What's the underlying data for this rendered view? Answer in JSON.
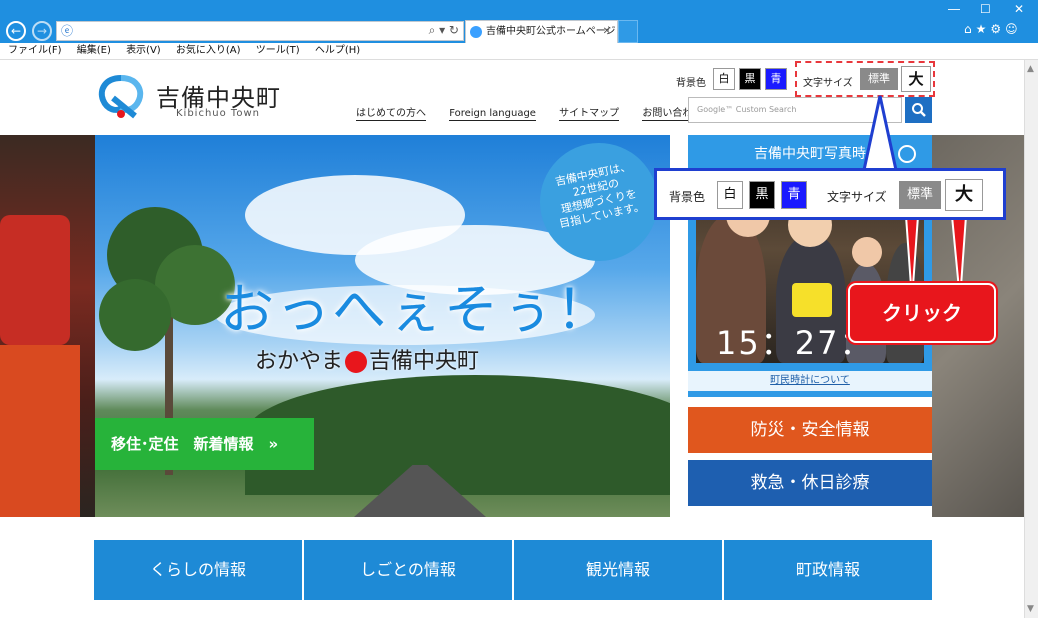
{
  "browser": {
    "tab_title": "吉備中央町公式ホームページ",
    "menu": [
      "ファイル(F)",
      "編集(E)",
      "表示(V)",
      "お気に入り(A)",
      "ツール(T)",
      "ヘルプ(H)"
    ]
  },
  "header": {
    "site_name": "吉備中央町",
    "site_name_roman": "Kibichuo Town",
    "bg_color_label": "背景色",
    "bg_white": "白",
    "bg_black": "黒",
    "bg_blue": "青",
    "font_size_label": "文字サイズ",
    "font_standard": "標準",
    "font_large": "大",
    "links": [
      "はじめての方へ",
      "Foreign language",
      "サイトマップ",
      "お問い合わせ"
    ],
    "search_placeholder": "Google™ Custom Search"
  },
  "hero": {
    "badge_lines": [
      "吉備中央町は、",
      "22世紀の",
      "理想郷づくりを",
      "目指しています。"
    ],
    "slogan": "おっへぇそぅ！",
    "subslogan_pre": "おかやま",
    "subslogan_post": "吉備中央町",
    "migrate_button": "移住･定住　新着情報　»"
  },
  "photo_panel": {
    "title": "吉備中央町写真時",
    "clock": "15：27：",
    "clock_link": "町民時計について"
  },
  "side_buttons": {
    "disaster": "防災・安全情報",
    "emergency": "救急・休日診療"
  },
  "callout": {
    "bg_color_label": "背景色",
    "bg_white": "白",
    "bg_black": "黒",
    "bg_blue": "青",
    "font_size_label": "文字サイズ",
    "font_standard": "標準",
    "font_large": "大",
    "click_label": "クリック"
  },
  "categories": [
    "くらしの情報",
    "しごとの情報",
    "観光情報",
    "町政情報"
  ],
  "colors": {
    "chrome_blue": "#1f8fe0",
    "category_blue": "#1e8ad6",
    "disaster_orange": "#e0571e",
    "emergency_blue": "#1e5fb0",
    "migrate_green": "#27b33a",
    "callout_red": "#e8161c"
  }
}
